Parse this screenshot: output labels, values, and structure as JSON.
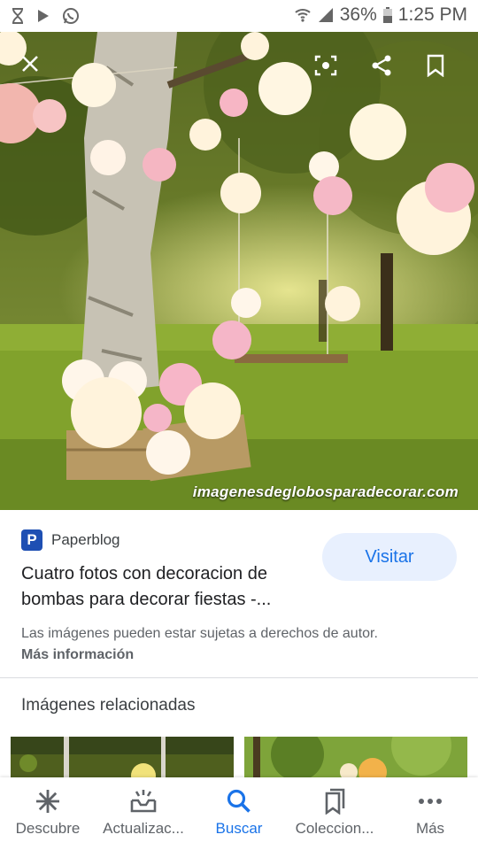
{
  "status_bar": {
    "battery": "36%",
    "time": "1:25 PM"
  },
  "hero": {
    "watermark": "imagenesdeglobosparadecorar.com"
  },
  "result": {
    "source_name": "Paperblog",
    "source_logo_letter": "P",
    "title": "Cuatro fotos con decoracion de bombas para decorar fiestas -...",
    "visit_label": "Visitar",
    "copyright": "Las imágenes pueden estar sujetas a derechos de autor.",
    "more_info": "Más información"
  },
  "related": {
    "heading": "Imágenes relacionadas"
  },
  "bottom_nav": {
    "items": [
      {
        "label": "Descubre",
        "icon": "asterisk-icon"
      },
      {
        "label": "Actualizac...",
        "icon": "inbox-icon"
      },
      {
        "label": "Buscar",
        "icon": "search-icon"
      },
      {
        "label": "Coleccion...",
        "icon": "bookmarks-icon"
      },
      {
        "label": "Más",
        "icon": "more-horizontal-icon"
      }
    ],
    "active_index": 2
  },
  "colors": {
    "accent": "#1a73e8",
    "visit_bg": "#e8f0fe",
    "source_logo": "#1e4fb3"
  }
}
